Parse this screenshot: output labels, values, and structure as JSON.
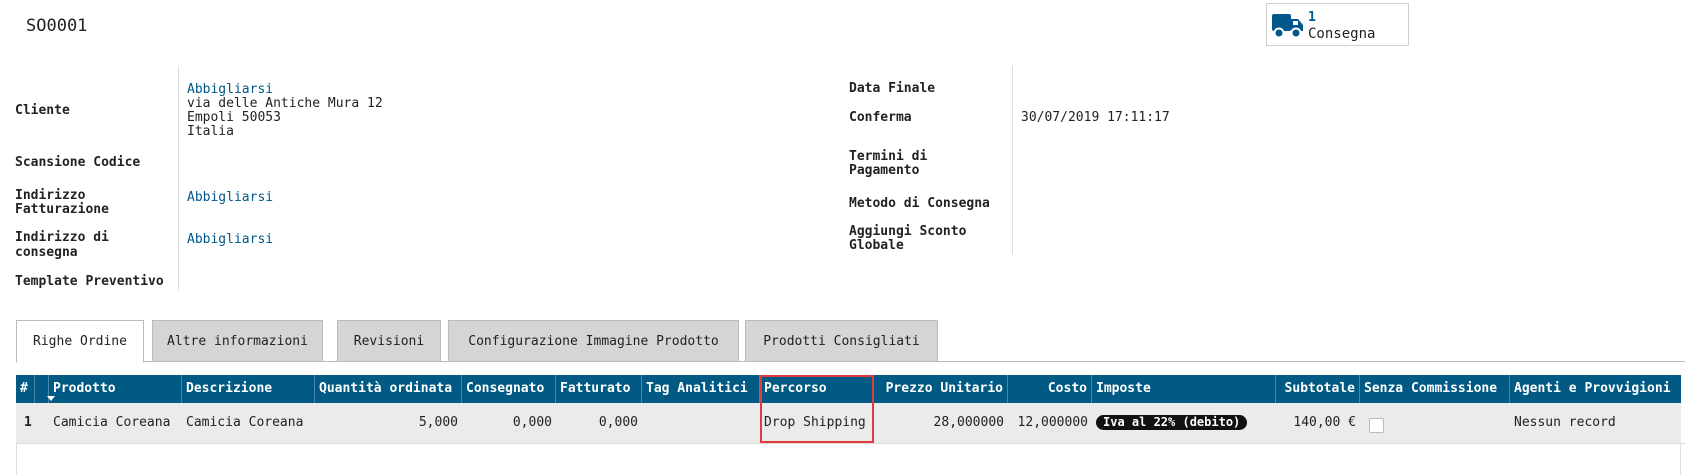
{
  "header": {
    "title": "SO0001",
    "smart_button": {
      "count": "1",
      "label": "Consegna",
      "icon": "truck-icon",
      "color": "#00578a"
    }
  },
  "form": {
    "left": {
      "cliente": {
        "label": "Cliente",
        "name": "Abbigliarsi",
        "street": "via delle Antiche Mura 12",
        "city": "Empoli 50053",
        "country": "Italia"
      },
      "scansione": {
        "label": "Scansione Codice"
      },
      "fatturazione": {
        "label_l1": "Indirizzo",
        "label_l2": "Fatturazione",
        "value": "Abbigliarsi"
      },
      "consegna": {
        "label_l1": "Indirizzo di",
        "label_l2": "consegna",
        "value": "Abbigliarsi"
      },
      "template": {
        "label": "Template Preventivo"
      }
    },
    "right": {
      "data_finale": {
        "label": "Data Finale"
      },
      "conferma": {
        "label": "Conferma",
        "value": "30/07/2019 17:11:17"
      },
      "termini": {
        "label_l1": "Termini di",
        "label_l2": "Pagamento"
      },
      "metodo": {
        "label": "Metodo di Consegna"
      },
      "sconto": {
        "label_l1": "Aggiungi Sconto",
        "label_l2": "Globale"
      }
    }
  },
  "tabs": [
    {
      "label": "Righe Ordine",
      "active": true
    },
    {
      "label": "Altre informazioni"
    },
    {
      "label": "Revisioni"
    },
    {
      "label": "Configurazione Immagine Prodotto"
    },
    {
      "label": "Prodotti Consigliati"
    }
  ],
  "table": {
    "header_color": "#005a83",
    "columns": [
      "#",
      "Prodotto",
      "Descrizione",
      "Quantità ordinata",
      "Consegnato",
      "Fatturato",
      "Tag Analitici",
      "Percorso",
      "Prezzo Unitario",
      "Costo",
      "Imposte",
      "Subtotale",
      "Senza Commissione",
      "Agenti e Provvigioni"
    ],
    "rows": [
      {
        "num": "1",
        "prodotto": "Camicia Coreana",
        "descrizione": "Camicia Coreana",
        "quantita": "5,000",
        "consegnato": "0,000",
        "fatturato": "0,000",
        "tag": "",
        "percorso": "Drop Shipping",
        "prezzo": "28,000000",
        "costo": "12,000000",
        "imposte": "Iva al 22% (debito)",
        "subtotale": "140,00 €",
        "senza_commissione": false,
        "agenti": "Nessun record"
      }
    ]
  },
  "highlight_color": "#e0393e"
}
